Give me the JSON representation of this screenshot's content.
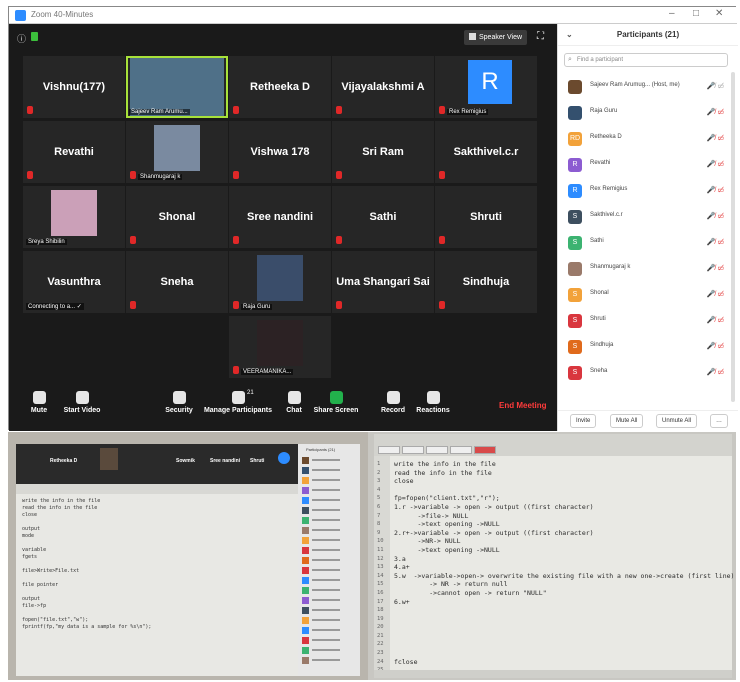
{
  "window": {
    "title": "Zoom 40-Minutes"
  },
  "video": {
    "speaker_view_label": "Speaker View",
    "tiles": [
      {
        "name": "Vishnu(177)",
        "type": "name"
      },
      {
        "name": "Sajeev Ram Arumu...",
        "type": "photo"
      },
      {
        "name": "Retheeka D",
        "type": "name"
      },
      {
        "name": "Vijayalakshmi A",
        "type": "name"
      },
      {
        "name": "Rex Remigius",
        "type": "avatar",
        "letter": "R"
      },
      {
        "name": "Revathi",
        "type": "name"
      },
      {
        "name": "Shanmugaraj k",
        "type": "photo"
      },
      {
        "name": "Vishwa 178",
        "type": "name"
      },
      {
        "name": "Sri Ram",
        "type": "name"
      },
      {
        "name": "Sakthivel.c.r",
        "type": "name"
      },
      {
        "name": "Sreya Shibilin",
        "type": "photo"
      },
      {
        "name": "Shonal",
        "type": "name"
      },
      {
        "name": "Sree nandini",
        "type": "name"
      },
      {
        "name": "Sathi",
        "type": "name"
      },
      {
        "name": "Shruti",
        "type": "name"
      },
      {
        "name": "Vasunthra",
        "type": "name",
        "status": "Connecting to a... ✓"
      },
      {
        "name": "Sneha",
        "type": "name"
      },
      {
        "name": "Raja Guru",
        "type": "photo"
      },
      {
        "name": "Uma Shangari Sai",
        "type": "name"
      },
      {
        "name": "Sindhuja",
        "type": "name"
      },
      {
        "name": "VEERAMANIKA...",
        "type": "photo"
      }
    ]
  },
  "toolbar": {
    "mute": "Mute",
    "start_video": "Start Video",
    "security": "Security",
    "manage_participants": "Manage Participants",
    "participant_count": "21",
    "chat": "Chat",
    "share_screen": "Share Screen",
    "record": "Record",
    "reactions": "Reactions",
    "end_meeting": "End Meeting"
  },
  "participants_panel": {
    "title": "Participants (21)",
    "search_placeholder": "Find a participant",
    "list": [
      {
        "name": "Sajeev Ram Arumug...  (Host, me)",
        "initials": "",
        "color": "#6b4a2e"
      },
      {
        "name": "Raja Guru",
        "initials": "",
        "color": "#34506e"
      },
      {
        "name": "Retheeka D",
        "initials": "RD",
        "color": "#f2a23a"
      },
      {
        "name": "Revathi",
        "initials": "R",
        "color": "#8c5cd1"
      },
      {
        "name": "Rex Remigius",
        "initials": "R",
        "color": "#2d8cff"
      },
      {
        "name": "Sakthivel.c.r",
        "initials": "S",
        "color": "#3d4f5f"
      },
      {
        "name": "Sathi",
        "initials": "S",
        "color": "#3cb371"
      },
      {
        "name": "Shanmugaraj k",
        "initials": "",
        "color": "#9a7a6a"
      },
      {
        "name": "Shonal",
        "initials": "S",
        "color": "#f2a23a"
      },
      {
        "name": "Shruti",
        "initials": "S",
        "color": "#d9363e"
      },
      {
        "name": "Sindhuja",
        "initials": "S",
        "color": "#e06a1c"
      },
      {
        "name": "Sneha",
        "initials": "S",
        "color": "#d9363e"
      }
    ],
    "invite": "Invite",
    "mute_all": "Mute All",
    "unmute_all": "Unmute All"
  },
  "photo_left": {
    "zoom_names": [
      "Retheeka D",
      "Sowmik",
      "Sree nandini",
      "Shruti"
    ],
    "participants_title": "Participants (21)",
    "code": "write the info in the file\nread the info in the file\nclose\n\noutput\nmode\n\nvariable\nfgets\n\nfile>Write>File.txt\n\nfile pointer\n\noutput\nfile->fp\n\nfopen(\"file.txt\",\"w\");\nfprintf(fp,\"my data is a sample for %s\\n\");"
  },
  "photo_right": {
    "line_numbers": "1\n2\n3\n4\n5\n6\n7\n8\n9\n10\n11\n12\n13\n14\n15\n16\n17\n18\n19\n20\n21\n22\n23\n24\n25",
    "code": "write the info in the file\nread the info in the file\nclose\n\nfp=fopen(\"client.txt\",\"r\");\n1.r ->variable -> open -> output ((first character)\n      ->file-> NULL\n      ->text opening ->NULL\n2.r+->variable -> open -> output ((first character)\n      ->NR-> NULL\n      ->text opening ->NULL\n3.a\n4.a+\n5.w  ->variable->open-> overwrite the existing file with a new one->create (first line)\n         -> NR -> return null\n         ->cannot open -> return \"NULL\"\n6.w+\n\n\n\n\n\n\nfclose"
  }
}
